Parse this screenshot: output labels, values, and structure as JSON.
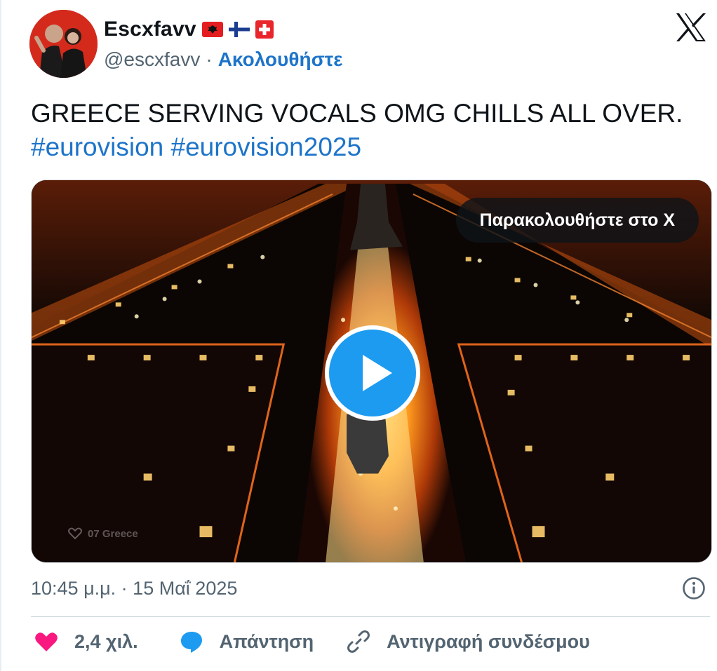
{
  "author": {
    "display_name": "Escxfavv",
    "handle": "@escxfavv",
    "separator": "·",
    "follow_label": "Ακολουθήστε",
    "flags": [
      "albania-flag-icon",
      "finland-flag-icon",
      "switzerland-flag-icon"
    ]
  },
  "tweet": {
    "text": "GREECE SERVING VOCALS OMG CHILLS ALL OVER.",
    "hashtags": "#eurovision #eurovision2025"
  },
  "media": {
    "watch_label": "Παρακολουθήστε στο X",
    "overlay_label": "07 Greece",
    "play_icon": "play-icon"
  },
  "meta": {
    "timestamp": "10:45 μ.μ. · 15 Μαΐ 2025"
  },
  "actions": {
    "likes_count": "2,4 χιλ.",
    "reply_label": "Απάντηση",
    "copy_link_label": "Αντιγραφή συνδέσμου"
  },
  "colors": {
    "link": "#1d74c9",
    "play": "#1d9bf0",
    "like": "#f91880",
    "muted": "#536471"
  }
}
